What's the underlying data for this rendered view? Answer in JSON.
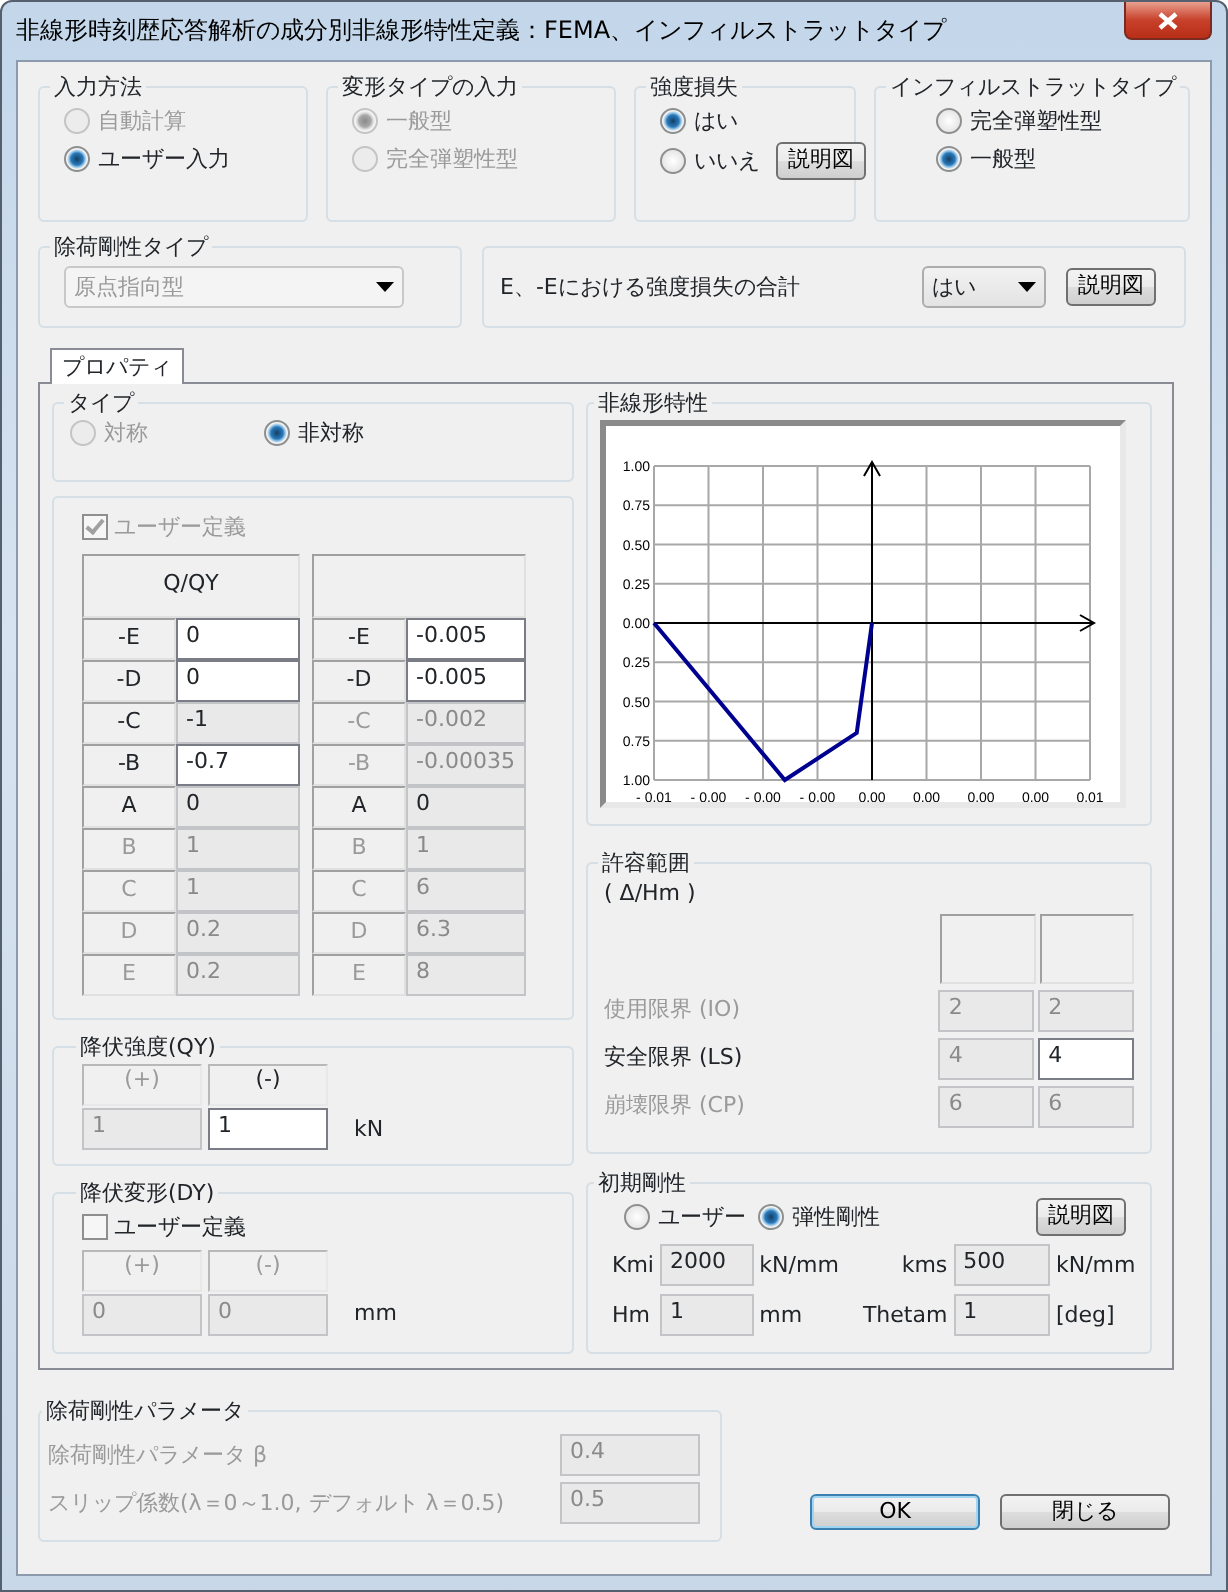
{
  "window": {
    "title": "非線形時刻歴応答解析の成分別非線形特性定義：FEMA、インフィルストラットタイプ"
  },
  "input_method": {
    "label": "入力方法",
    "options": [
      {
        "label": "自動計算",
        "selected": false,
        "disabled": true
      },
      {
        "label": "ユーザー入力",
        "selected": true,
        "disabled": false
      }
    ]
  },
  "deformation_type": {
    "label": "変形タイプの入力",
    "options": [
      {
        "label": "一般型",
        "selected": true,
        "disabled": true
      },
      {
        "label": "完全弾塑性型",
        "selected": false,
        "disabled": true
      }
    ]
  },
  "strength_loss": {
    "label": "強度損失",
    "options": [
      {
        "label": "はい",
        "selected": true,
        "disabled": false
      },
      {
        "label": "いいえ",
        "selected": false,
        "disabled": false
      }
    ],
    "button": "説明図"
  },
  "infill_strut_type": {
    "label": "インフィルストラットタイプ",
    "options": [
      {
        "label": "完全弾塑性型",
        "selected": false,
        "disabled": false
      },
      {
        "label": "一般型",
        "selected": true,
        "disabled": false
      }
    ]
  },
  "unloading_stiffness_type": {
    "label": "除荷剛性タイプ",
    "value": "原点指向型",
    "disabled": true
  },
  "strength_loss_total": {
    "label": "E、-Eにおける強度損失の合計",
    "value": "はい",
    "button": "説明図"
  },
  "tabs": [
    {
      "label": "プロパティ",
      "selected": true
    }
  ],
  "type_group": {
    "label": "タイプ",
    "options": [
      {
        "label": "対称",
        "selected": false,
        "disabled": true
      },
      {
        "label": "非対称",
        "selected": true,
        "disabled": false
      }
    ]
  },
  "user_definition": {
    "label": "ユーザー定義",
    "checked": true,
    "disabled": true
  },
  "table": {
    "column_headers": [
      "Q/QY"
    ],
    "rows": [
      {
        "left_label": {
          "text": "-E",
          "disabled": false
        },
        "q": {
          "text": "0",
          "editable": true
        },
        "right_label": {
          "text": "-E",
          "disabled": false
        },
        "d": {
          "text": "-0.005",
          "editable": true
        }
      },
      {
        "left_label": {
          "text": "-D",
          "disabled": false
        },
        "q": {
          "text": "0",
          "editable": true
        },
        "right_label": {
          "text": "-D",
          "disabled": false
        },
        "d": {
          "text": "-0.005",
          "editable": true
        }
      },
      {
        "left_label": {
          "text": "-C",
          "disabled": false
        },
        "q": {
          "text": "-1",
          "editable": false
        },
        "right_label": {
          "text": "-C",
          "disabled": true
        },
        "d": {
          "text": "-0.002",
          "editable": false
        }
      },
      {
        "left_label": {
          "text": "-B",
          "disabled": false
        },
        "q": {
          "text": "-0.7",
          "editable": true
        },
        "right_label": {
          "text": "-B",
          "disabled": true
        },
        "d": {
          "text": "-0.00035",
          "editable": false
        }
      },
      {
        "left_label": {
          "text": "A",
          "disabled": false
        },
        "q": {
          "text": "0",
          "editable": false
        },
        "right_label": {
          "text": "A",
          "disabled": false
        },
        "d": {
          "text": "0",
          "editable": false
        }
      },
      {
        "left_label": {
          "text": "B",
          "disabled": true
        },
        "q": {
          "text": "1",
          "editable": false
        },
        "right_label": {
          "text": "B",
          "disabled": true
        },
        "d": {
          "text": "1",
          "editable": false
        }
      },
      {
        "left_label": {
          "text": "C",
          "disabled": true
        },
        "q": {
          "text": "1",
          "editable": false
        },
        "right_label": {
          "text": "C",
          "disabled": true
        },
        "d": {
          "text": "6",
          "editable": false
        }
      },
      {
        "left_label": {
          "text": "D",
          "disabled": true
        },
        "q": {
          "text": "0.2",
          "editable": false
        },
        "right_label": {
          "text": "D",
          "disabled": true
        },
        "d": {
          "text": "6.3",
          "editable": false
        }
      },
      {
        "left_label": {
          "text": "E",
          "disabled": true
        },
        "q": {
          "text": "0.2",
          "editable": false
        },
        "right_label": {
          "text": "E",
          "disabled": true
        },
        "d": {
          "text": "8",
          "editable": false
        }
      }
    ]
  },
  "yield_strength": {
    "label": "降伏強度(QY)",
    "headers": [
      {
        "text": "(+)",
        "disabled": true
      },
      {
        "text": "(-)",
        "disabled": false
      }
    ],
    "values": [
      {
        "text": "1",
        "editable": false
      },
      {
        "text": "1",
        "editable": true
      }
    ],
    "unit": "kN"
  },
  "yield_deformation": {
    "label": "降伏変形(DY)",
    "user_definition": {
      "label": "ユーザー定義",
      "checked": false,
      "disabled": false
    },
    "headers": [
      {
        "text": "(+)",
        "disabled": true
      },
      {
        "text": "(-)",
        "disabled": true
      }
    ],
    "values": [
      {
        "text": "0",
        "editable": false
      },
      {
        "text": "0",
        "editable": false
      }
    ],
    "unit": "mm"
  },
  "nonlinear_characteristics": {
    "label": "非線形特性",
    "chart_data": {
      "type": "line",
      "x": [
        -0.005,
        -0.002,
        -0.00035,
        0
      ],
      "series": [
        {
          "color": "#000090",
          "values": [
            0,
            -1,
            -0.7,
            0
          ]
        }
      ],
      "grid": true,
      "xlim": [
        -0.005,
        0.005
      ],
      "ylim": [
        -1,
        1
      ],
      "xticks": [
        {
          "value": -0.005,
          "label": "- 0.01"
        },
        {
          "value": -0.00375,
          "label": "- 0.00"
        },
        {
          "value": -0.0025,
          "label": "- 0.00"
        },
        {
          "value": -0.00125,
          "label": "- 0.00"
        },
        {
          "value": 0,
          "label": "0.00"
        },
        {
          "value": 0.00125,
          "label": "0.00"
        },
        {
          "value": 0.0025,
          "label": "0.00"
        },
        {
          "value": 0.00375,
          "label": "0.00"
        },
        {
          "value": 0.005,
          "label": "0.01"
        }
      ],
      "yticks": [
        {
          "value": 1,
          "label": "1.00"
        },
        {
          "value": 0.75,
          "label": "0.75"
        },
        {
          "value": 0.5,
          "label": "0.50"
        },
        {
          "value": 0.25,
          "label": "0.25"
        },
        {
          "value": 0,
          "label": "0.00"
        },
        {
          "value": -0.25,
          "label": "0.25"
        },
        {
          "value": -0.5,
          "label": "0.50"
        },
        {
          "value": -0.75,
          "label": "0.75"
        },
        {
          "value": -1,
          "label": "1.00"
        }
      ]
    }
  },
  "allowable_range": {
    "label": "許容範囲",
    "unit_label": "( Δ/Hm )",
    "rows": [
      {
        "label": "使用限界 (IO)",
        "disabled": true,
        "values": [
          {
            "text": "2",
            "editable": false
          },
          {
            "text": "2",
            "editable": false
          }
        ]
      },
      {
        "label": "安全限界 (LS)",
        "disabled": false,
        "values": [
          {
            "text": "4",
            "editable": false
          },
          {
            "text": "4",
            "editable": true
          }
        ]
      },
      {
        "label": "崩壊限界 (CP)",
        "disabled": true,
        "values": [
          {
            "text": "6",
            "editable": false
          },
          {
            "text": "6",
            "editable": false
          }
        ]
      }
    ]
  },
  "initial_stiffness": {
    "label": "初期剛性",
    "options": [
      {
        "label": "ユーザー",
        "selected": false,
        "disabled": false
      },
      {
        "label": "弾性剛性",
        "selected": true,
        "disabled": false
      }
    ],
    "button": "説明図",
    "fields": [
      {
        "label": "Kmi",
        "value": "2000",
        "unit": "kN/mm"
      },
      {
        "label": "kms",
        "value": "500",
        "unit": "kN/mm"
      },
      {
        "label": "Hm",
        "value": "1",
        "unit": "mm"
      },
      {
        "label": "Thetam",
        "value": "1",
        "unit": "[deg]"
      }
    ]
  },
  "unloading_parameters": {
    "label": "除荷剛性パラメータ",
    "rows": [
      {
        "label": "除荷剛性パラメータ β",
        "value": "0.4",
        "disabled": true
      },
      {
        "label": "スリップ係数(λ＝0～1.0, デフォルト λ＝0.5)",
        "value": "0.5",
        "disabled": true
      }
    ]
  },
  "buttons": [
    {
      "label": "OK",
      "default": true
    },
    {
      "label": "閉じる",
      "default": false
    }
  ]
}
